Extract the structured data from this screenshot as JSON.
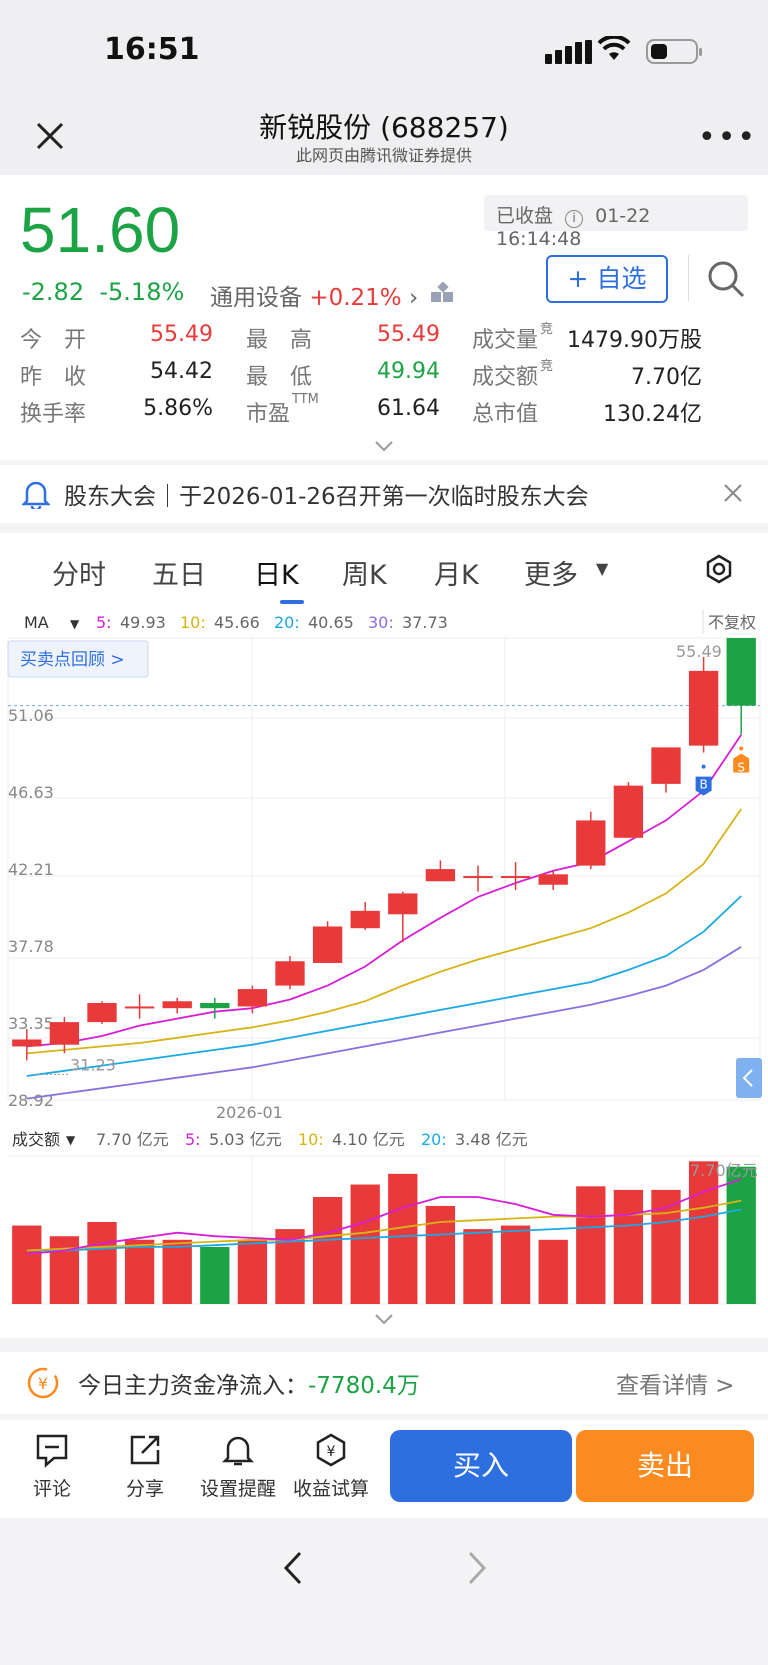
{
  "status": {
    "time": "16:51"
  },
  "nav": {
    "title": "新锐股份 (688257)",
    "subtitle": "此网页由腾讯微证券提供"
  },
  "quote": {
    "price": "51.60",
    "change": "-2.82",
    "change_pct": "-5.18%",
    "industry": "通用设备",
    "industry_pct": "+0.21%",
    "closed_label": "已收盘",
    "closed_time": "01-22 16:14:48",
    "add_watch": "+ 自选",
    "stats": [
      [
        {
          "l": "今　开",
          "v": "55.49",
          "c": "red"
        },
        {
          "l": "最　高",
          "v": "55.49",
          "c": "red"
        },
        {
          "l": "成交量",
          "sup": "竞",
          "v": "1479.90万股",
          "c": "dark"
        }
      ],
      [
        {
          "l": "昨　收",
          "v": "54.42",
          "c": "dark"
        },
        {
          "l": "最　低",
          "v": "49.94",
          "c": "green"
        },
        {
          "l": "成交额",
          "sup": "竞",
          "v": "7.70亿",
          "c": "dark"
        }
      ],
      [
        {
          "l": "换手率",
          "v": "5.86%",
          "c": "dark"
        },
        {
          "l": "市盈",
          "sup": "TTM",
          "v": "61.64",
          "c": "dark"
        },
        {
          "l": "总市值",
          "v": "130.24亿",
          "c": "dark"
        }
      ]
    ]
  },
  "notice": {
    "text": "股东大会｜于2026-01-26召开第一次临时股东大会"
  },
  "tabs": [
    "分时",
    "五日",
    "日K",
    "周K",
    "月K",
    "更多"
  ],
  "active_tab": "日K",
  "chart": {
    "ma_label": "MA",
    "ma": [
      {
        "k": "5:",
        "v": "49.93",
        "color": "#d61ed6"
      },
      {
        "k": "10:",
        "v": "45.66",
        "color": "#d8b314"
      },
      {
        "k": "20:",
        "v": "40.65",
        "color": "#1ba8e6"
      },
      {
        "k": "30:",
        "v": "37.73",
        "color": "#8a6fe0"
      }
    ],
    "adjust": "不复权",
    "review_btn": "买卖点回顾 >",
    "price_ticks": [
      "51.06",
      "46.63",
      "42.21",
      "37.78",
      "33.35",
      "28.92"
    ],
    "high_label": "55.49",
    "low_label": "31.23",
    "date_label": "2026-01",
    "vol_label": "成交额",
    "vol_items": [
      {
        "k": "",
        "v": "7.70 亿元",
        "color": "#555"
      },
      {
        "k": "5:",
        "v": "5.03 亿元",
        "color": "#d61ed6"
      },
      {
        "k": "10:",
        "v": "4.10 亿元",
        "color": "#d8b314"
      },
      {
        "k": "20:",
        "v": "3.48 亿元",
        "color": "#1ba8e6"
      }
    ],
    "vol_max_label": "7.70亿元",
    "buy_marker": "B",
    "sell_marker": "S"
  },
  "chart_data": {
    "type": "candlestick",
    "ylim": [
      28.92,
      55.49
    ],
    "candles": [
      {
        "o": 32.0,
        "c": 32.4,
        "h": 33.0,
        "l": 31.2
      },
      {
        "o": 32.1,
        "c": 33.4,
        "h": 33.7,
        "l": 31.6
      },
      {
        "o": 33.4,
        "c": 34.5,
        "h": 34.6,
        "l": 33.3
      },
      {
        "o": 34.3,
        "c": 34.3,
        "h": 35.0,
        "l": 33.6
      },
      {
        "o": 34.2,
        "c": 34.6,
        "h": 34.8,
        "l": 33.9
      },
      {
        "o": 34.5,
        "c": 34.2,
        "h": 34.8,
        "l": 33.6
      },
      {
        "o": 34.3,
        "c": 35.3,
        "h": 35.5,
        "l": 33.9
      },
      {
        "o": 35.5,
        "c": 36.9,
        "h": 37.2,
        "l": 35.3
      },
      {
        "o": 36.8,
        "c": 38.9,
        "h": 39.2,
        "l": 36.8
      },
      {
        "o": 38.8,
        "c": 39.8,
        "h": 40.3,
        "l": 38.7
      },
      {
        "o": 39.6,
        "c": 40.8,
        "h": 40.9,
        "l": 38.0
      },
      {
        "o": 41.5,
        "c": 42.2,
        "h": 42.7,
        "l": 41.5
      },
      {
        "o": 41.8,
        "c": 41.8,
        "h": 42.4,
        "l": 40.9
      },
      {
        "o": 41.8,
        "c": 41.8,
        "h": 42.6,
        "l": 41.0
      },
      {
        "o": 41.3,
        "c": 41.9,
        "h": 42.1,
        "l": 41.0
      },
      {
        "o": 42.4,
        "c": 45.0,
        "h": 45.5,
        "l": 42.2
      },
      {
        "o": 44.0,
        "c": 47.0,
        "h": 47.2,
        "l": 44.0
      },
      {
        "o": 47.1,
        "c": 49.2,
        "h": 49.2,
        "l": 46.6
      },
      {
        "o": 49.3,
        "c": 53.6,
        "h": 54.4,
        "l": 48.9
      },
      {
        "o": 55.49,
        "c": 51.6,
        "h": 55.49,
        "l": 49.94
      }
    ],
    "ma5": [
      32.0,
      32.2,
      32.6,
      33.2,
      33.6,
      34.0,
      34.2,
      34.7,
      35.5,
      36.6,
      38.1,
      39.4,
      40.6,
      41.4,
      42.1,
      42.6,
      43.8,
      45.0,
      46.7,
      49.93
    ],
    "ma10": [
      31.6,
      31.8,
      32.0,
      32.2,
      32.5,
      32.8,
      33.1,
      33.5,
      34.0,
      34.6,
      35.5,
      36.3,
      37.0,
      37.6,
      38.2,
      38.8,
      39.7,
      40.8,
      42.5,
      45.66
    ],
    "ma20": [
      30.3,
      30.6,
      30.9,
      31.2,
      31.5,
      31.8,
      32.1,
      32.5,
      32.9,
      33.3,
      33.7,
      34.1,
      34.5,
      34.9,
      35.3,
      35.7,
      36.4,
      37.2,
      38.6,
      40.65
    ],
    "ma30": [
      29.0,
      29.3,
      29.6,
      29.9,
      30.2,
      30.5,
      30.8,
      31.2,
      31.6,
      32.0,
      32.4,
      32.8,
      33.2,
      33.6,
      34.0,
      34.4,
      34.9,
      35.5,
      36.4,
      37.73
    ],
    "volume": [
      4.4,
      3.8,
      4.6,
      3.6,
      3.6,
      3.2,
      3.6,
      4.2,
      6.0,
      6.7,
      7.3,
      5.5,
      4.2,
      4.4,
      3.6,
      6.6,
      6.4,
      6.4,
      8.0,
      7.7
    ],
    "vol_ma5": [
      2.8,
      3.0,
      3.4,
      3.7,
      4.0,
      3.8,
      3.7,
      3.6,
      4.0,
      4.6,
      5.4,
      6.0,
      6.0,
      5.6,
      5.0,
      4.9,
      5.0,
      5.4,
      6.3,
      7.0
    ],
    "vol_ma10": [
      3.0,
      3.1,
      3.2,
      3.3,
      3.4,
      3.5,
      3.6,
      3.6,
      3.8,
      4.0,
      4.3,
      4.6,
      4.7,
      4.8,
      4.9,
      4.9,
      5.0,
      5.1,
      5.4,
      5.8
    ],
    "vol_ma20": [
      3.0,
      3.0,
      3.1,
      3.2,
      3.2,
      3.3,
      3.4,
      3.5,
      3.6,
      3.7,
      3.8,
      3.9,
      4.0,
      4.1,
      4.2,
      4.3,
      4.4,
      4.6,
      4.9,
      5.3
    ],
    "vol_max": 8.3,
    "buy_index": 18,
    "sell_index": 19
  },
  "capital": {
    "label": "今日主力资金净流入：",
    "value": "-7780.4万",
    "detail": "查看详情 >"
  },
  "actions": [
    "评论",
    "分享",
    "设置提醒",
    "收益试算"
  ],
  "buy_label": "买入",
  "sell_label": "卖出",
  "colors": {
    "up": "#e83a3a",
    "down": "#1ca345",
    "accent": "#2e6fe0",
    "sell": "#fb8a20"
  }
}
